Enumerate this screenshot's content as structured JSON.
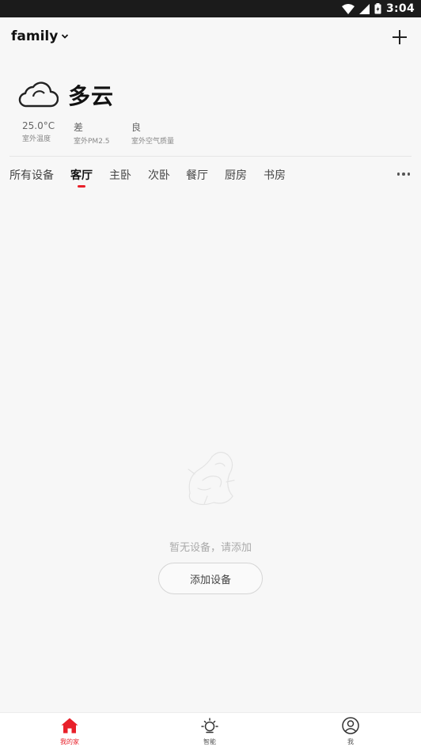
{
  "status_bar": {
    "time": "3:04"
  },
  "header": {
    "home_name": "family",
    "add_icon": "plus-icon"
  },
  "weather": {
    "condition": "多云",
    "icon": "cloud-icon",
    "metrics": [
      {
        "value": "25.0°C",
        "label": "室外温度"
      },
      {
        "value": "差",
        "label": "室外PM2.5"
      },
      {
        "value": "良",
        "label": "室外空气质量"
      }
    ]
  },
  "tabs": {
    "items": [
      "所有设备",
      "客厅",
      "主卧",
      "次卧",
      "餐厅",
      "厨房",
      "书房"
    ],
    "active_index": 1
  },
  "empty_state": {
    "message": "暂无设备，请添加",
    "button_label": "添加设备"
  },
  "bottom_nav": {
    "items": [
      {
        "label": "我的家",
        "icon": "home-icon"
      },
      {
        "label": "智能",
        "icon": "sun-icon"
      },
      {
        "label": "我",
        "icon": "user-icon"
      }
    ],
    "active_index": 0
  },
  "colors": {
    "accent": "#e8202a",
    "background": "#f7f7f7"
  }
}
